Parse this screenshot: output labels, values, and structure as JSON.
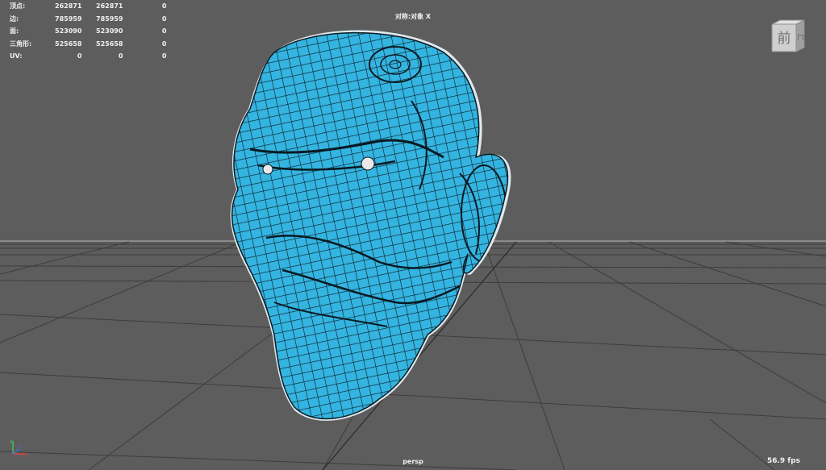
{
  "viewport": {
    "camera": "persp",
    "fps": "56.9 fps",
    "symmetry": "对称:对象 X",
    "view_cube_face": "前",
    "colors": {
      "background": "#5d5d5d",
      "mesh_fill": "#34b4e0",
      "mesh_wire": "#0a1a22",
      "grid_line": "#3c3c3c",
      "horizon": "#8a8a8a"
    }
  },
  "hud_stats": {
    "rows": [
      {
        "label": "顶点:",
        "v1": "262871",
        "v2": "262871",
        "v3": "0"
      },
      {
        "label": "边:",
        "v1": "785959",
        "v2": "785959",
        "v3": "0"
      },
      {
        "label": "面:",
        "v1": "523090",
        "v2": "523090",
        "v3": "0"
      },
      {
        "label": "三角形:",
        "v1": "525658",
        "v2": "525658",
        "v3": "0"
      },
      {
        "label": "UV:",
        "v1": "0",
        "v2": "0",
        "v3": "0"
      }
    ]
  },
  "icons": {
    "view_cube": "view-cube-icon",
    "axis": "axis-triad-icon",
    "model": "head-mesh"
  }
}
